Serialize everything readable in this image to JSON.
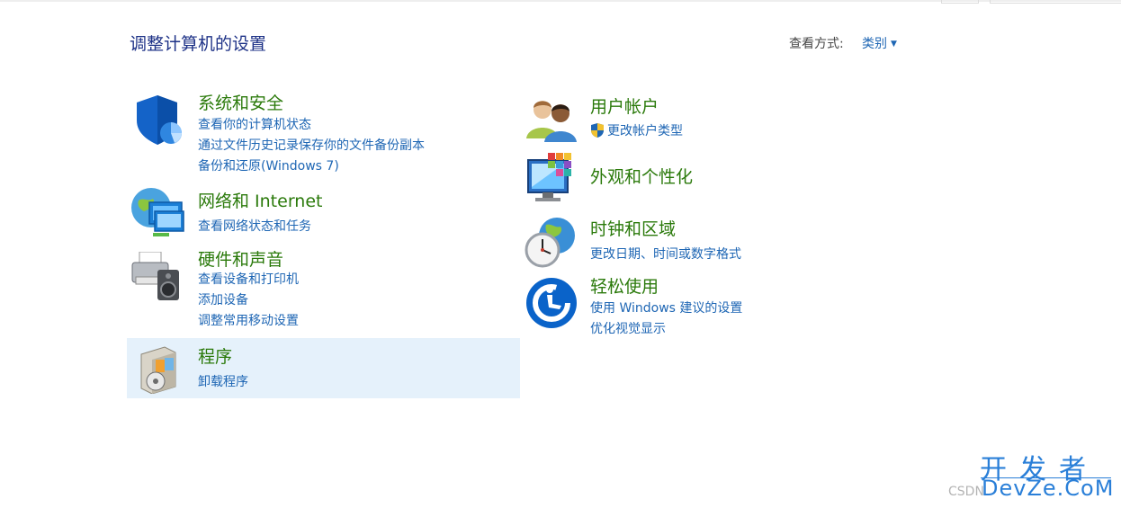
{
  "header": {
    "title": "调整计算机的设置",
    "view_by_label": "查看方式:",
    "view_by_value": "类别"
  },
  "categories": [
    {
      "id": "system-security",
      "title": "系统和安全",
      "icon": "shield-icon",
      "links": [
        "查看你的计算机状态",
        "通过文件历史记录保存你的文件备份副本",
        "备份和还原(Windows 7)"
      ]
    },
    {
      "id": "network-internet",
      "title": "网络和 Internet",
      "icon": "network-globe-icon",
      "links": [
        "查看网络状态和任务"
      ]
    },
    {
      "id": "hardware-sound",
      "title": "硬件和声音",
      "icon": "printer-speaker-icon",
      "links": [
        "查看设备和打印机",
        "添加设备",
        "调整常用移动设置"
      ]
    },
    {
      "id": "programs",
      "title": "程序",
      "icon": "programs-box-icon",
      "highlighted": true,
      "links": [
        "卸载程序"
      ]
    },
    {
      "id": "user-accounts",
      "title": "用户帐户",
      "icon": "users-icon",
      "links": [
        "更改帐户类型"
      ],
      "link_icon": "uac-shield-icon"
    },
    {
      "id": "appearance",
      "title": "外观和个性化",
      "icon": "monitor-palette-icon",
      "links": []
    },
    {
      "id": "clock-region",
      "title": "时钟和区域",
      "icon": "clock-globe-icon",
      "links": [
        "更改日期、时间或数字格式"
      ]
    },
    {
      "id": "ease-of-access",
      "title": "轻松使用",
      "icon": "ease-of-access-icon",
      "links": [
        "使用 Windows 建议的设置",
        "优化视觉显示"
      ]
    }
  ],
  "watermark": {
    "chinese": "开发者",
    "english": "DevZe.CoM",
    "csdn": "CSDN"
  },
  "colors": {
    "category_title": "#2b7a0b",
    "link": "#1e66b4",
    "page_title": "#1e3287",
    "highlight": "#e5f1fb"
  }
}
